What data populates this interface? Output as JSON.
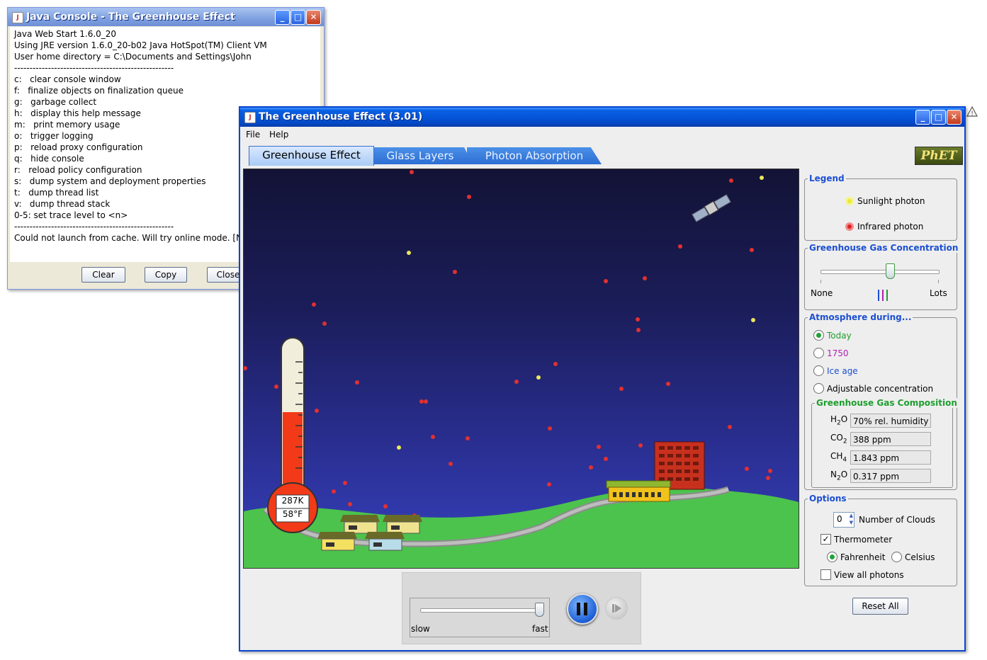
{
  "console": {
    "title": "Java Console - The Greenhouse Effect",
    "lines": [
      "Java Web Start 1.6.0_20",
      "Using JRE version 1.6.0_20-b02 Java HotSpot(TM) Client VM",
      "User home directory = C:\\Documents and Settings\\John",
      "----------------------------------------------------",
      "c:   clear console window",
      "f:   finalize objects on finalization queue",
      "g:   garbage collect",
      "h:   display this help message",
      "m:   print memory usage",
      "o:   trigger logging",
      "p:   reload proxy configuration",
      "q:   hide console",
      "r:   reload policy configuration",
      "s:   dump system and deployment properties",
      "t:   dump thread list",
      "v:   dump thread stack",
      "0-5: set trace level to <n>",
      "----------------------------------------------------",
      "Could not launch from cache. Will try online mode. [Nee"
    ],
    "buttons": {
      "clear": "Clear",
      "copy": "Copy",
      "close": "Close"
    }
  },
  "app": {
    "title": "The Greenhouse Effect (3.01)",
    "menu": {
      "file": "File",
      "help": "Help"
    },
    "tabs": [
      "Greenhouse Effect",
      "Glass Layers",
      "Photon Absorption"
    ],
    "logo": "PhET",
    "thermometer": {
      "kelvin": "287K",
      "fahrenheit": "58°F"
    },
    "speed": {
      "slow": "slow",
      "fast": "fast"
    }
  },
  "panel": {
    "legend": {
      "title": "Legend",
      "sunlight": "Sunlight photon",
      "infrared": "Infrared photon"
    },
    "concentration": {
      "title": "Greenhouse Gas Concentration",
      "none": "None",
      "lots": "Lots",
      "level": 0.69
    },
    "atmosphere": {
      "title": "Atmosphere during...",
      "options": [
        {
          "label": "Today",
          "color": "#1e9e2e"
        },
        {
          "label": "1750",
          "color": "#b31fb3"
        },
        {
          "label": "Ice age",
          "color": "#1c4fd1"
        },
        {
          "label": "Adjustable concentration",
          "color": "#000000"
        }
      ],
      "selected_index": 0
    },
    "composition": {
      "title": "Greenhouse Gas Composition",
      "h2o": "70% rel. humidity",
      "co2": "388 ppm",
      "ch4": "1.843 ppm",
      "n2o": "0.317 ppm"
    },
    "options": {
      "title": "Options",
      "clouds_value": "0",
      "clouds_label": "Number of Clouds",
      "thermometer_label": "Thermometer",
      "thermometer_checked": true,
      "fahrenheit_label": "Fahrenheit",
      "celsius_label": "Celsius",
      "unit_selected": "Fahrenheit",
      "view_all_label": "View all photons",
      "view_all_checked": false
    },
    "reset_label": "Reset All"
  },
  "colors": {
    "titlebar": "#0555d9",
    "sky_top": "#131336",
    "sky_bottom": "#3742c0",
    "ground": "#4cc34c",
    "accent": "#1c4fd1"
  }
}
